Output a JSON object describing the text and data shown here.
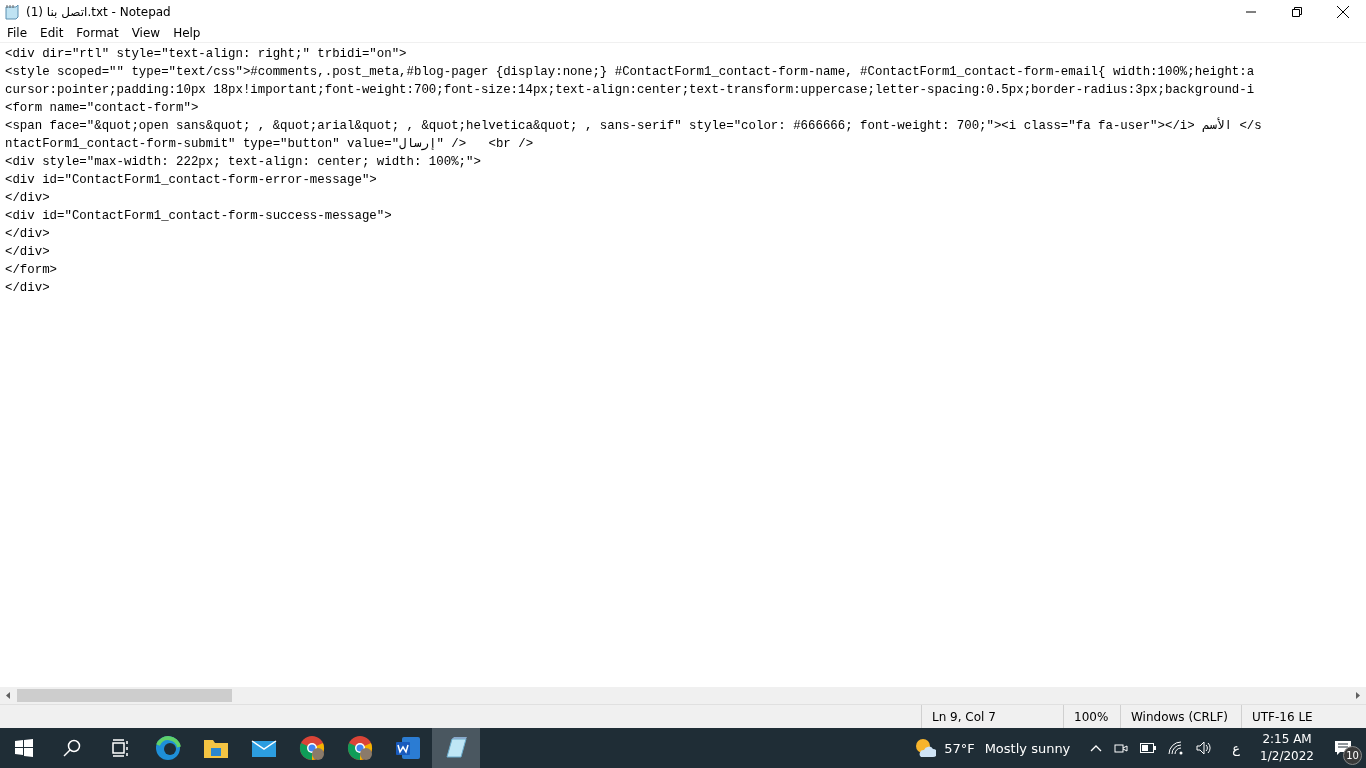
{
  "window": {
    "title": "اتصل بنا (1).txt - Notepad"
  },
  "menu": [
    "File",
    "Edit",
    "Format",
    "View",
    "Help"
  ],
  "editor": {
    "lines": [
      "<div dir=\"rtl\" style=\"text-align: right;\" trbidi=\"on\">",
      "<style scoped=\"\" type=\"text/css\">#comments,.post_meta,#blog-pager {display:none;} #ContactForm1_contact-form-name, #ContactForm1_contact-form-email{ width:100%;height:a",
      "cursor:pointer;padding:10px 18px!important;font-weight:700;font-size:14px;text-align:center;text-transform:uppercase;letter-spacing:0.5px;border-radius:3px;background-i",
      "<form name=\"contact-form\">",
      "<span face=\"&quot;open sans&quot; , &quot;arial&quot; , &quot;helvetica&quot; , sans-serif\" style=\"color: #666666; font-weight: 700;\"><i class=\"fa fa-user\"></i> الأسم </s",
      "ntactForm1_contact-form-submit\" type=\"button\" value=\"إرسال\" />   <br />",
      "<div style=\"max-width: 222px; text-align: center; width: 100%;\">",
      "<div id=\"ContactForm1_contact-form-error-message\">",
      "</div>",
      "<div id=\"ContactForm1_contact-form-success-message\">",
      "</div>",
      "</div>",
      "</form>",
      "</div>"
    ]
  },
  "status_bar": {
    "position": "Ln 9, Col 7",
    "zoom": "100%",
    "line_endings": "Windows (CRLF)",
    "encoding": "UTF-16 LE"
  },
  "taskbar": {
    "apps": [
      {
        "kind": "edge",
        "selected": false
      },
      {
        "kind": "folder",
        "selected": false
      },
      {
        "kind": "mail",
        "selected": false
      },
      {
        "kind": "chrome",
        "selected": false
      },
      {
        "kind": "chrome",
        "selected": false
      },
      {
        "kind": "word",
        "selected": false
      },
      {
        "kind": "notepad",
        "selected": true
      }
    ],
    "weather": {
      "temperature": "57°F",
      "condition": "Mostly sunny"
    },
    "language": "ع",
    "time": "2:15 AM",
    "date": "1/2/2022",
    "notifications": "10"
  }
}
